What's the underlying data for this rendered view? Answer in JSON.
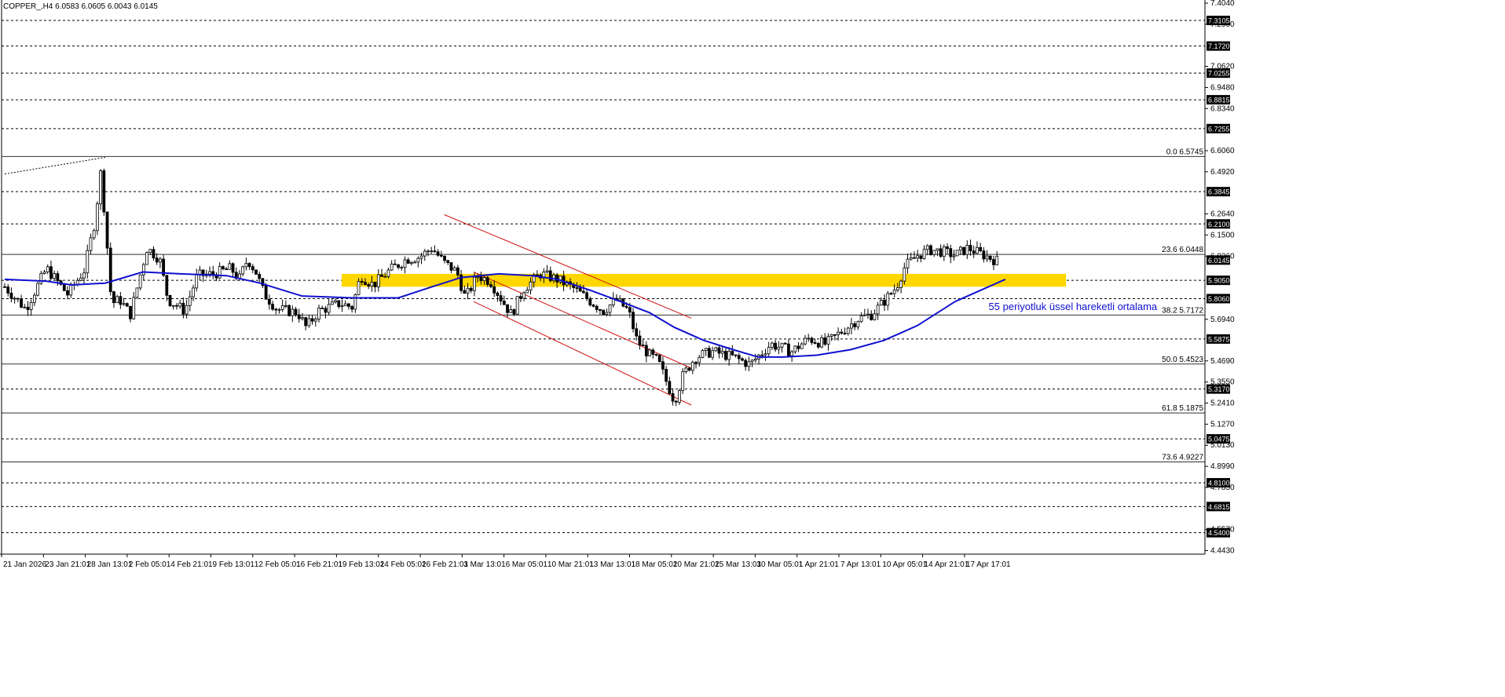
{
  "header": {
    "title": "COPPER_,H4  6.0583 6.0605 6.0043 6.0145"
  },
  "chart_data": {
    "type": "candlestick",
    "symbol": "COPPER_",
    "timeframe": "H4",
    "ohlc_last": {
      "open": 6.0583,
      "high": 6.0605,
      "low": 6.0043,
      "close": 6.0145
    },
    "ylim": [
      4.424,
      7.404
    ],
    "y_ticks": [
      "7.4040",
      "7.2900",
      "7.0620",
      "6.9480",
      "6.8340",
      "6.6060",
      "6.4920",
      "6.2640",
      "6.1500",
      "6.0360",
      "5.6940",
      "5.4690",
      "5.3550",
      "5.2410",
      "5.1270",
      "5.0130",
      "4.8990",
      "4.7850",
      "4.5570",
      "4.4430"
    ],
    "x_labels": [
      "21 Jan 2026",
      "23 Jan 21:01",
      "28 Jan 13:01",
      "2 Feb 05:01",
      "4 Feb 21:01",
      "9 Feb 13:01",
      "12 Feb 05:01",
      "16 Feb 21:01",
      "19 Feb 13:01",
      "24 Feb 05:01",
      "26 Feb 21:01",
      "3 Mar 13:01",
      "6 Mar 05:01",
      "10 Mar 21:01",
      "13 Mar 13:01",
      "18 Mar 05:01",
      "20 Mar 21:01",
      "25 Mar 13:01",
      "30 Mar 05:01",
      "1 Apr 21:01",
      "7 Apr 13:01",
      "10 Apr 05:01",
      "14 Apr 21:01",
      "17 Apr 17:01"
    ],
    "price_levels": [
      {
        "value": 7.3105,
        "label": "7.3105"
      },
      {
        "value": 7.172,
        "label": "7.1720"
      },
      {
        "value": 7.0255,
        "label": "7.0255"
      },
      {
        "value": 6.8815,
        "label": "6.8815"
      },
      {
        "value": 6.7255,
        "label": "6.7255"
      },
      {
        "value": 6.3845,
        "label": "6.3845"
      },
      {
        "value": 6.21,
        "label": "6.2100"
      },
      {
        "value": 5.905,
        "label": "5.9050"
      },
      {
        "value": 5.806,
        "label": "5.8060"
      },
      {
        "value": 5.5875,
        "label": "5.5875"
      },
      {
        "value": 5.317,
        "label": "5.3170"
      },
      {
        "value": 5.0475,
        "label": "5.0475"
      },
      {
        "value": 4.81,
        "label": "4.8100"
      },
      {
        "value": 4.6815,
        "label": "4.6815"
      },
      {
        "value": 4.54,
        "label": "4.5400"
      }
    ],
    "current_price": {
      "value": 6.0145,
      "label": "6.0145"
    },
    "fibonacci": [
      {
        "level": "0.0",
        "value": 6.5745,
        "label": "0.0 6.5745"
      },
      {
        "level": "23.6",
        "value": 6.0448,
        "label": "23.6 6.0448"
      },
      {
        "level": "38.2",
        "value": 5.7172,
        "label": "38.2 5.7172"
      },
      {
        "level": "50.0",
        "value": 5.4523,
        "label": "50.0 5.4523"
      },
      {
        "level": "61.8",
        "value": 5.1875,
        "label": "61.8 5.1875"
      },
      {
        "level": "73.6",
        "value": 4.9227,
        "label": "73.6 4.9227"
      }
    ],
    "zone": {
      "from": 5.87,
      "to": 5.94,
      "color": "#ffd700"
    },
    "channel": {
      "color": "#d01010",
      "upper": {
        "start": [
          10.5,
          6.26
        ],
        "end": [
          16.4,
          5.7
        ]
      },
      "lower": {
        "start": [
          11.2,
          5.79
        ],
        "end": [
          16.4,
          5.23
        ]
      },
      "middle": {
        "start": [
          11.2,
          5.95
        ],
        "end": [
          16.4,
          5.43
        ]
      }
    },
    "ema": {
      "period": 55,
      "color": "#1010d0",
      "points": [
        [
          0,
          5.91
        ],
        [
          1,
          5.9
        ],
        [
          1.6,
          5.88
        ],
        [
          2.4,
          5.89
        ],
        [
          3.3,
          5.95
        ],
        [
          4.2,
          5.94
        ],
        [
          5.3,
          5.93
        ],
        [
          6.1,
          5.89
        ],
        [
          7.1,
          5.82
        ],
        [
          8.3,
          5.81
        ],
        [
          9.4,
          5.81
        ],
        [
          10.2,
          5.87
        ],
        [
          10.9,
          5.92
        ],
        [
          11.8,
          5.94
        ],
        [
          12.6,
          5.93
        ],
        [
          13.2,
          5.91
        ],
        [
          14.0,
          5.85
        ],
        [
          14.6,
          5.8
        ],
        [
          15.4,
          5.73
        ],
        [
          16.0,
          5.65
        ],
        [
          16.7,
          5.58
        ],
        [
          17.4,
          5.53
        ],
        [
          18.0,
          5.49
        ],
        [
          18.6,
          5.49
        ],
        [
          19.4,
          5.5
        ],
        [
          20.2,
          5.53
        ],
        [
          21.0,
          5.58
        ],
        [
          21.8,
          5.66
        ],
        [
          22.7,
          5.79
        ],
        [
          23.4,
          5.86
        ],
        [
          23.9,
          5.91
        ]
      ]
    },
    "annotation": {
      "text": "55 periyotluk üssel hareketli ortalama",
      "x": 23.5,
      "y": 5.745
    },
    "swing_line": {
      "start": [
        0,
        6.48
      ],
      "end": [
        2.4,
        6.57
      ]
    },
    "price_path": [
      [
        0,
        5.87
      ],
      [
        0.5,
        5.75
      ],
      [
        1,
        5.97
      ],
      [
        1.5,
        5.83
      ],
      [
        1.9,
        5.96
      ],
      [
        2.15,
        6.22
      ],
      [
        2.3,
        6.5
      ],
      [
        2.45,
        6.08
      ],
      [
        2.55,
        5.78
      ],
      [
        2.75,
        5.8
      ],
      [
        3.0,
        5.72
      ],
      [
        3.4,
        6.08
      ],
      [
        3.7,
        6.02
      ],
      [
        3.9,
        5.8
      ],
      [
        4.3,
        5.74
      ],
      [
        4.6,
        5.93
      ],
      [
        5.0,
        5.94
      ],
      [
        5.4,
        5.97
      ],
      [
        5.6,
        5.91
      ],
      [
        5.8,
        6.02
      ],
      [
        6.0,
        5.95
      ],
      [
        6.2,
        5.83
      ],
      [
        6.5,
        5.75
      ],
      [
        7.0,
        5.73
      ],
      [
        7.2,
        5.65
      ],
      [
        7.5,
        5.74
      ],
      [
        8.0,
        5.78
      ],
      [
        8.3,
        5.76
      ],
      [
        8.5,
        5.93
      ],
      [
        8.8,
        5.88
      ],
      [
        9.2,
        5.96
      ],
      [
        9.6,
        6.02
      ],
      [
        9.9,
        6.03
      ],
      [
        10.2,
        6.08
      ],
      [
        10.5,
        6.0
      ],
      [
        10.8,
        5.95
      ],
      [
        11.0,
        5.81
      ],
      [
        11.3,
        5.93
      ],
      [
        11.6,
        5.9
      ],
      [
        11.9,
        5.79
      ],
      [
        12.1,
        5.72
      ],
      [
        12.4,
        5.86
      ],
      [
        12.8,
        5.94
      ],
      [
        13.2,
        5.91
      ],
      [
        13.6,
        5.86
      ],
      [
        14.0,
        5.79
      ],
      [
        14.3,
        5.74
      ],
      [
        14.6,
        5.8
      ],
      [
        14.9,
        5.74
      ],
      [
        15.1,
        5.58
      ],
      [
        15.4,
        5.5
      ],
      [
        15.6,
        5.47
      ],
      [
        15.8,
        5.36
      ],
      [
        16.0,
        5.25
      ],
      [
        16.2,
        5.39
      ],
      [
        16.5,
        5.49
      ],
      [
        16.9,
        5.52
      ],
      [
        17.4,
        5.49
      ],
      [
        17.8,
        5.45
      ],
      [
        18.3,
        5.56
      ],
      [
        18.8,
        5.52
      ],
      [
        19.2,
        5.59
      ],
      [
        19.6,
        5.56
      ],
      [
        20.0,
        5.63
      ],
      [
        20.4,
        5.7
      ],
      [
        20.7,
        5.72
      ],
      [
        21.0,
        5.79
      ],
      [
        21.3,
        5.87
      ],
      [
        21.5,
        5.98
      ],
      [
        21.8,
        6.04
      ],
      [
        22.1,
        6.07
      ],
      [
        22.4,
        6.06
      ],
      [
        22.7,
        6.04
      ],
      [
        23.0,
        6.08
      ],
      [
        23.4,
        6.04
      ],
      [
        23.7,
        6.01
      ]
    ]
  }
}
